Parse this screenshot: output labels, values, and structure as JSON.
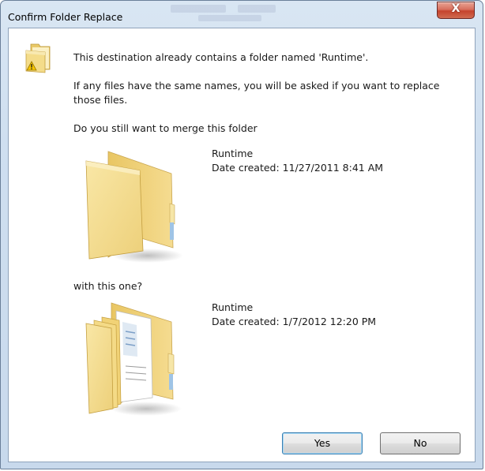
{
  "window": {
    "title": "Confirm Folder Replace",
    "close_glyph": "X"
  },
  "message": {
    "line1": "This destination already contains a folder named 'Runtime'.",
    "line2": "If any files have the same names, you will be asked if you want to replace those files.",
    "line3": "Do you still want to merge this folder",
    "line4": "with this one?"
  },
  "existing_folder": {
    "name": "Runtime",
    "date_created": "Date created: 11/27/2011 8:41 AM",
    "icon": "folder-icon"
  },
  "new_folder": {
    "name": "Runtime",
    "date_created": "Date created: 1/7/2012 12:20 PM",
    "icon": "folder-with-documents-icon"
  },
  "buttons": {
    "yes": "Yes",
    "no": "No"
  },
  "colors": {
    "folder": "#f2d883",
    "warning": "#f5c400",
    "close_button": "#c8462f",
    "default_button_border": "#3c7fb1"
  }
}
